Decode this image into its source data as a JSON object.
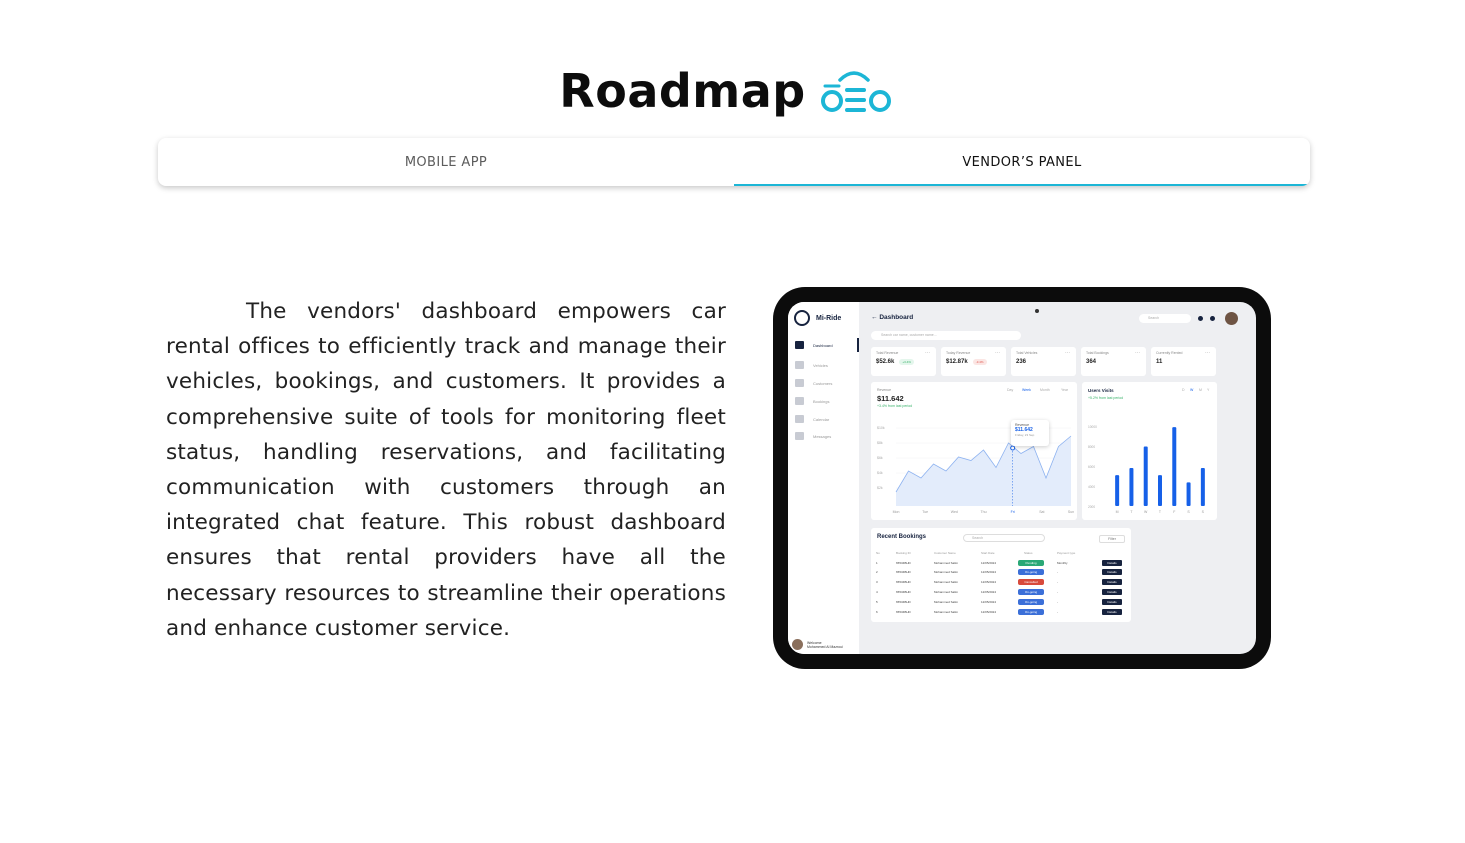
{
  "page": {
    "title": "Roadmap"
  },
  "tabs": [
    {
      "label": "MOBILE APP",
      "active": false
    },
    {
      "label": "VENDOR’S PANEL",
      "active": true
    }
  ],
  "description": "The vendors' dashboard empowers car rental offices to efficiently track and manage their vehicles, bookings, and customers. It provides a comprehensive suite of tools for monitoring fleet status, handling reservations, and facilitating communication with customers through an integrated chat feature. This robust dashboard ensures that rental providers have all the necessary resources to streamline their operations and enhance customer service.",
  "colors": {
    "accent": "#1cb6d6",
    "navy": "#17233f",
    "chart_blue": "#1660e8"
  },
  "dashboard": {
    "brand": "Mi-Ride",
    "header": "Dashboard",
    "search_placeholder": "Search car name, customer name...",
    "top_search": "Search",
    "nav": [
      {
        "label": "Dashboard",
        "active": true
      },
      {
        "label": "Vehicles",
        "active": false
      },
      {
        "label": "Customers",
        "active": false
      },
      {
        "label": "Bookings",
        "active": false
      },
      {
        "label": "Calendar",
        "active": false
      },
      {
        "label": "Messages",
        "active": false
      }
    ],
    "welcome": {
      "line1": "Welcome",
      "line2": "Mohammed Al Mazroui"
    },
    "stats": [
      {
        "label": "Total Revenue",
        "value": "$52.6k",
        "badge": "+3.4%",
        "badge_color": "#38b26a"
      },
      {
        "label": "Today Revenue",
        "value": "$12.87k",
        "badge": "-3.4%",
        "badge_color": "#e0554d"
      },
      {
        "label": "Total Vehicles",
        "value": "236",
        "badge": "",
        "badge_color": ""
      },
      {
        "label": "Total Bookings",
        "value": "364",
        "badge": "",
        "badge_color": ""
      },
      {
        "label": "Currently Rented",
        "value": "11",
        "badge": "",
        "badge_color": ""
      }
    ],
    "revenue": {
      "label": "Revenue",
      "value": "$11.642",
      "sub": "+3.4% from last period",
      "ranges": [
        "Day",
        "Week",
        "Month",
        "Year"
      ],
      "tooltip": {
        "label": "Revenue",
        "value": "$11.642",
        "date": "Friday, 23 Sep"
      }
    },
    "visits": {
      "label": "Users Visits",
      "sub": "+5.2% from last period",
      "ranges": [
        "D",
        "W",
        "M",
        "Y"
      ]
    },
    "bookings": {
      "title": "Recent Bookings",
      "search": "Search",
      "filter": "Filter",
      "columns": [
        "No",
        "Booking ID",
        "Customer Name",
        "Start Date",
        "Status",
        "Payment type",
        ""
      ],
      "rows": [
        {
          "no": "1",
          "id": "65534BHD",
          "name": "Mohammed Salim",
          "date": "12/05/2024",
          "status": "Pending",
          "status_color": "#2aa876",
          "pay": "Monthly",
          "action": "Details"
        },
        {
          "no": "2",
          "id": "65534BHD",
          "name": "Mohammed Salim",
          "date": "12/05/2024",
          "status": "On-going",
          "status_color": "#3b6fd8",
          "pay": "-",
          "action": "Details"
        },
        {
          "no": "3",
          "id": "65534BHD",
          "name": "Mohammed Salim",
          "date": "12/05/2024",
          "status": "Cancelled",
          "status_color": "#d84a3b",
          "pay": "-",
          "action": "Details"
        },
        {
          "no": "4",
          "id": "65534BHD",
          "name": "Mohammed Salim",
          "date": "12/05/2024",
          "status": "On-going",
          "status_color": "#3b6fd8",
          "pay": "-",
          "action": "Details"
        },
        {
          "no": "5",
          "id": "65534BHD",
          "name": "Mohammed Salim",
          "date": "12/05/2024",
          "status": "On-going",
          "status_color": "#3b6fd8",
          "pay": "-",
          "action": "Details"
        },
        {
          "no": "6",
          "id": "65534BHD",
          "name": "Mohammed Salim",
          "date": "12/05/2024",
          "status": "On-going",
          "status_color": "#3b6fd8",
          "pay": "-",
          "action": "Details"
        }
      ]
    }
  },
  "chart_data": [
    {
      "type": "area",
      "title": "Revenue",
      "categories": [
        "Mon",
        "Tue",
        "Wed",
        "Thu",
        "Fri",
        "Sat",
        "Sun"
      ],
      "y_ticks": [
        "$10k",
        "$8k",
        "$6k",
        "$4k",
        "$2k"
      ],
      "values": [
        2,
        5,
        4,
        6,
        5,
        7,
        6.5,
        8,
        5.5,
        9,
        7.5,
        8.5,
        4,
        8.5,
        10
      ],
      "ylim": [
        0,
        12
      ]
    },
    {
      "type": "bar",
      "title": "Users Visits",
      "categories": [
        "M",
        "T",
        "W",
        "T",
        "F",
        "S",
        "S"
      ],
      "y_ticks": [
        "10000",
        "8000",
        "6000",
        "4000",
        "2000"
      ],
      "series": [
        {
          "values": [
            4300,
            5300,
            8300,
            4300,
            11000,
            3300,
            5300
          ]
        }
      ],
      "ylim": [
        0,
        12000
      ]
    }
  ]
}
